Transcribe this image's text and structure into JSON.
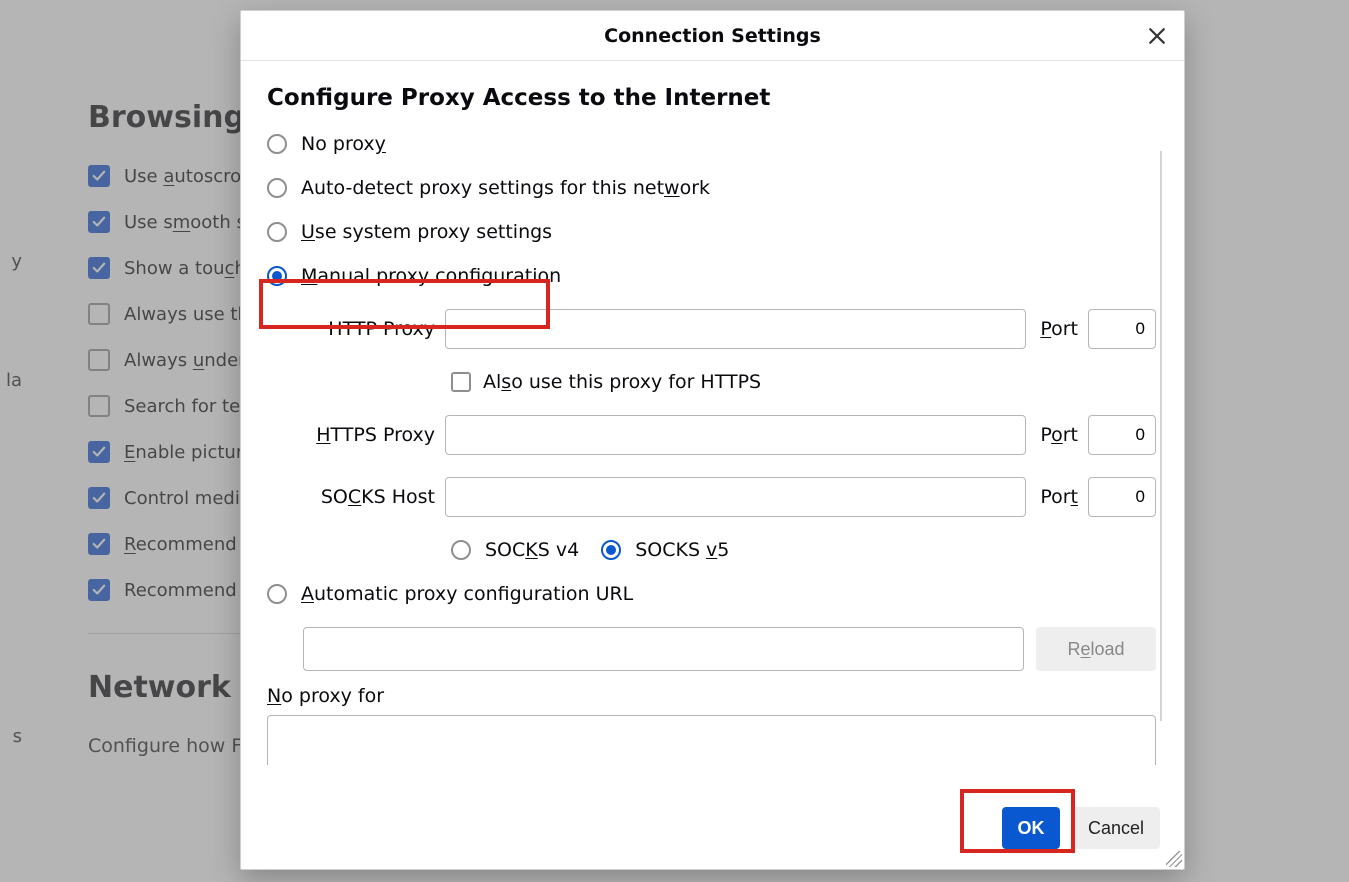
{
  "bg": {
    "heading_browsing": "Browsing",
    "items": [
      {
        "checked": true,
        "pre": "Use ",
        "ukey": "a",
        "post": "utoscrollin"
      },
      {
        "checked": true,
        "pre": "Use s",
        "ukey": "m",
        "post": "ooth sc"
      },
      {
        "checked": true,
        "pre": "Show a tou",
        "ukey": "c",
        "post": "h k"
      },
      {
        "checked": false,
        "pre": "Always use the",
        "ukey": "",
        "post": ""
      },
      {
        "checked": false,
        "pre": "Always ",
        "ukey": "u",
        "post": "nderlin"
      },
      {
        "checked": false,
        "pre": "Search for te",
        "ukey": "x",
        "post": "t"
      },
      {
        "checked": true,
        "pre": "",
        "ukey": "E",
        "post": "nable picture-"
      },
      {
        "checked": true,
        "pre": "Control media ",
        "ukey": "",
        "post": ""
      },
      {
        "checked": true,
        "pre": "",
        "ukey": "R",
        "post": "ecommend e"
      },
      {
        "checked": true,
        "pre": "Recommend ",
        "ukey": "f",
        "post": "e"
      }
    ],
    "heading_network": "Network Set",
    "network_para": "Configure how Fire",
    "left1": "y",
    "left2": "la",
    "left3": "s"
  },
  "dialog": {
    "title": "Connection Settings",
    "section": "Configure Proxy Access to the Internet",
    "radios": {
      "no_proxy": {
        "pre": "No prox",
        "ukey": "y",
        "post": ""
      },
      "auto_detect": {
        "pre": "Auto-detect proxy settings for this net",
        "ukey": "w",
        "post": "ork"
      },
      "system": {
        "pre": "",
        "ukey": "U",
        "post": "se system proxy settings"
      },
      "manual": {
        "pre": "",
        "ukey": "M",
        "post": "anual proxy configuration"
      },
      "autourl": {
        "pre": "",
        "ukey": "A",
        "post": "utomatic proxy configuration URL"
      }
    },
    "http_label": "HTTP Proxy",
    "http_port_label_pre": "",
    "http_port_ukey": "P",
    "http_port_label_post": "ort",
    "http_port_value": "0",
    "also_https_pre": "Al",
    "also_https_ukey": "s",
    "also_https_post": "o use this proxy for HTTPS",
    "https_label_pre": "",
    "https_label_ukey": "H",
    "https_label_post": "TTPS Proxy",
    "https_port_label_pre": "P",
    "https_port_ukey": "o",
    "https_port_label_post": "rt",
    "https_port_value": "0",
    "socks_label_pre": "SO",
    "socks_label_ukey": "C",
    "socks_label_post": "KS Host",
    "socks_port_label_pre": "Por",
    "socks_port_ukey": "t",
    "socks_port_label_post": "",
    "socks_port_value": "0",
    "socks_v4_pre": "SOC",
    "socks_v4_ukey": "K",
    "socks_v4_post": "S v4",
    "socks_v5_pre": "SOCKS ",
    "socks_v5_ukey": "v",
    "socks_v5_post": "5",
    "reload_pre": "R",
    "reload_ukey": "e",
    "reload_post": "load",
    "noproxy_pre": "",
    "noproxy_ukey": "N",
    "noproxy_post": "o proxy for",
    "ok": "OK",
    "cancel": "Cancel"
  }
}
